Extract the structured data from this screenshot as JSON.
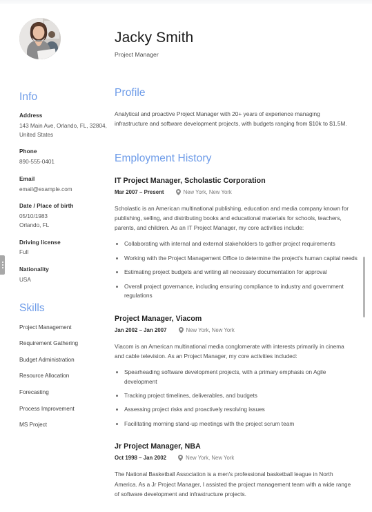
{
  "header": {
    "name": "Jacky Smith",
    "subtitle": "Project Manager",
    "avatar_icon": "person-photo-avatar"
  },
  "sidebar": {
    "info_heading": "Info",
    "info_items": [
      {
        "label": "Address",
        "value": "143 Main Ave, Orlando, FL, 32804, United States"
      },
      {
        "label": "Phone",
        "value": "890-555-0401"
      },
      {
        "label": "Email",
        "value": "email@example.com"
      },
      {
        "label": "Date / Place of birth",
        "value": "05/10/1983\nOrlando, FL"
      },
      {
        "label": "Driving license",
        "value": "Full"
      },
      {
        "label": "Nationality",
        "value": "USA"
      }
    ],
    "skills_heading": "Skills",
    "skills": [
      "Project Management",
      "Requirement Gathering",
      "Budget Administration",
      "Resource Allocation",
      "Forecasting",
      "Process Improvement",
      "MS Project"
    ]
  },
  "main": {
    "profile_heading": "Profile",
    "profile_text": "Analytical and proactive Project Manager with 20+ years of experience managing infrastructure and software development projects, with budgets ranging from $10k to $1.5M.",
    "employment_heading": "Employment History",
    "jobs": [
      {
        "role": "IT Project Manager, Scholastic Corporation",
        "dates": "Mar 2007 – Present",
        "location": "New York, New York",
        "location_icon": "map-pin-icon",
        "description": "Scholastic is an American multinational publishing, education and media company known for publishing, selling, and distributing books and educational materials for schools, teachers, parents, and children. As an IT Project Manager, my core activities include:",
        "bullets": [
          "Collaborating with internal and external stakeholders to gather project requirements",
          "Working with the Project Management Office to determine the project's human capital needs",
          "Estimating project budgets and writing all necessary documentation for approval",
          "Overall project governance, including ensuring compliance to industry and government regulations"
        ]
      },
      {
        "role": "Project Manager, Viacom",
        "dates": "Jan 2002 – Jan 2007",
        "location": "New York, New York",
        "location_icon": "map-pin-icon",
        "description": "Viacom is an American multinational media conglomerate with interests primarily in cinema and cable television. As an Project Manager, my core activities included:",
        "bullets": [
          "Spearheading software development projects, with a primary emphasis on Agile development",
          "Tracking project timelines, deliverables, and budgets",
          "Assessing project risks and proactively resolving issues",
          "Facilitating morning stand-up meetings with the project scrum team"
        ]
      },
      {
        "role": "Jr Project Manager, NBA",
        "dates": "Oct 1998 – Jan 2002",
        "location": "New York, New York",
        "location_icon": "map-pin-icon",
        "description": "The National Basketball Association is a men's professional basketball league in North America. As a Jr Project Manager, I assisted the project management team with a wide range of software development and infrastructure projects.",
        "bullets": []
      }
    ]
  },
  "chrome": {
    "drag_handle_icon": "drag-handle-icon",
    "scrollbar_icon": "vertical-scrollbar"
  },
  "colors": {
    "heading_blue": "#6b9ae8",
    "body_text": "#4a4a4a",
    "strong_text": "#1f1f1f"
  }
}
